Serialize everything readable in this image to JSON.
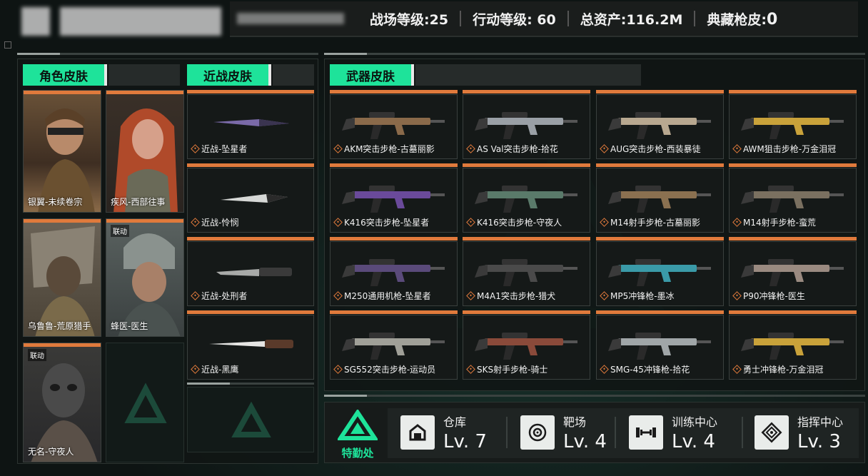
{
  "header": {
    "stats": [
      {
        "label": "战场等级:",
        "value": "25"
      },
      {
        "label": "行动等级: ",
        "value": "60"
      },
      {
        "label": "总资产:",
        "value": "116.2M"
      },
      {
        "label": "典藏枪皮:",
        "value": "0"
      }
    ]
  },
  "sections": {
    "character": "角色皮肤",
    "melee": "近战皮肤",
    "weapon": "武器皮肤"
  },
  "characters": [
    {
      "label": "银翼-未续卷宗",
      "collab": ""
    },
    {
      "label": "疾风-西部往事",
      "collab": ""
    },
    {
      "label": "乌鲁鲁-荒原猎手",
      "collab": ""
    },
    {
      "label": "蜂医-医生",
      "collab": "联动"
    },
    {
      "label": "无名-守夜人",
      "collab": "联动"
    }
  ],
  "melee": [
    {
      "label": "近战-坠星者"
    },
    {
      "label": "近战-怜悯"
    },
    {
      "label": "近战-处刑者"
    },
    {
      "label": "近战-黑鹰"
    }
  ],
  "weapons": [
    {
      "label": "AKM突击步枪-古墓丽影",
      "color": "#8a6a4a"
    },
    {
      "label": "AS Val突击步枪-拾花",
      "color": "#9aa0a6"
    },
    {
      "label": "AUG突击步枪-西装暴徒",
      "color": "#b8a890"
    },
    {
      "label": "AWM狙击步枪-万金泪冠",
      "color": "#c9a23a"
    },
    {
      "label": "K416突击步枪-坠星者",
      "color": "#6a4a9a"
    },
    {
      "label": "K416突击步枪-守夜人",
      "color": "#5a7a6a"
    },
    {
      "label": "M14射手步枪-古墓丽影",
      "color": "#8a7050"
    },
    {
      "label": "M14射手步枪-蛮荒",
      "color": "#7a7060"
    },
    {
      "label": "M250通用机枪-坠星者",
      "color": "#5a4a7a"
    },
    {
      "label": "M4A1突击步枪-猎犬",
      "color": "#4a4a4a"
    },
    {
      "label": "MP5冲锋枪-墨冰",
      "color": "#3a9aa8"
    },
    {
      "label": "P90冲锋枪-医生",
      "color": "#9a8a80"
    },
    {
      "label": "SG552突击步枪-运动员",
      "color": "#a0a098"
    },
    {
      "label": "SKS射手步枪-骑士",
      "color": "#8a4a3a"
    },
    {
      "label": "SMG-45冲锋枪-拾花",
      "color": "#a0a6a8"
    },
    {
      "label": "勇士冲锋枪-万金泪冠",
      "color": "#c9a23a"
    }
  ],
  "hq": {
    "label": "特勤处"
  },
  "facilities": [
    {
      "name": "仓库",
      "level": "Lv. 7",
      "icon": "warehouse-icon"
    },
    {
      "name": "靶场",
      "level": "Lv. 4",
      "icon": "target-icon"
    },
    {
      "name": "训练中心",
      "level": "Lv. 4",
      "icon": "dumbbell-icon"
    },
    {
      "name": "指挥中心",
      "level": "Lv. 3",
      "icon": "command-icon"
    }
  ]
}
